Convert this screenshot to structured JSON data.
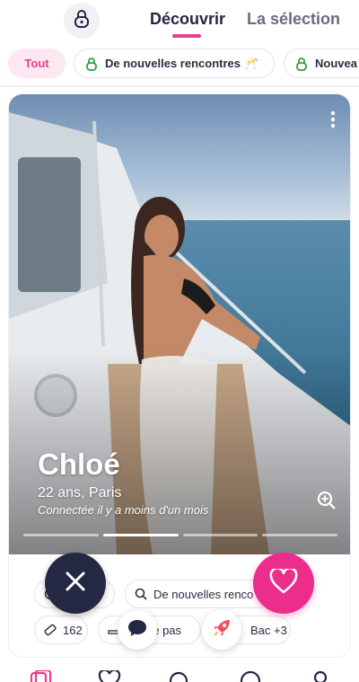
{
  "header": {
    "tabs": [
      {
        "label": "Découvrir",
        "active": true
      },
      {
        "label": "La sélection",
        "active": false
      }
    ]
  },
  "filters": [
    {
      "label": "Tout",
      "active": true
    },
    {
      "label": "De nouvelles rencontres 🥂",
      "active": false
    },
    {
      "label": "Nouvea",
      "active": false
    }
  ],
  "profile": {
    "name": "Chloé",
    "age_city": "22 ans, Paris",
    "last_seen": "Connectée il y a moins d'un mois",
    "photo_count": 4,
    "photo_index": 2,
    "tags": {
      "looking_for": "De nouvelles renco",
      "height": "162",
      "smoking": "ne pas",
      "education": "Bac +3"
    }
  },
  "colors": {
    "accent": "#e83e8c",
    "like": "#ec2d8c",
    "pass": "#252843",
    "boost": "#f04e5e"
  },
  "icons": {
    "lock": "lock-icon",
    "more": "more-vertical-icon",
    "zoom": "zoom-in-icon",
    "pass": "close-icon",
    "like": "heart-icon",
    "message": "chat-bubble-icon",
    "boost": "rocket-icon",
    "search": "search-icon",
    "ruler": "ruler-icon"
  }
}
